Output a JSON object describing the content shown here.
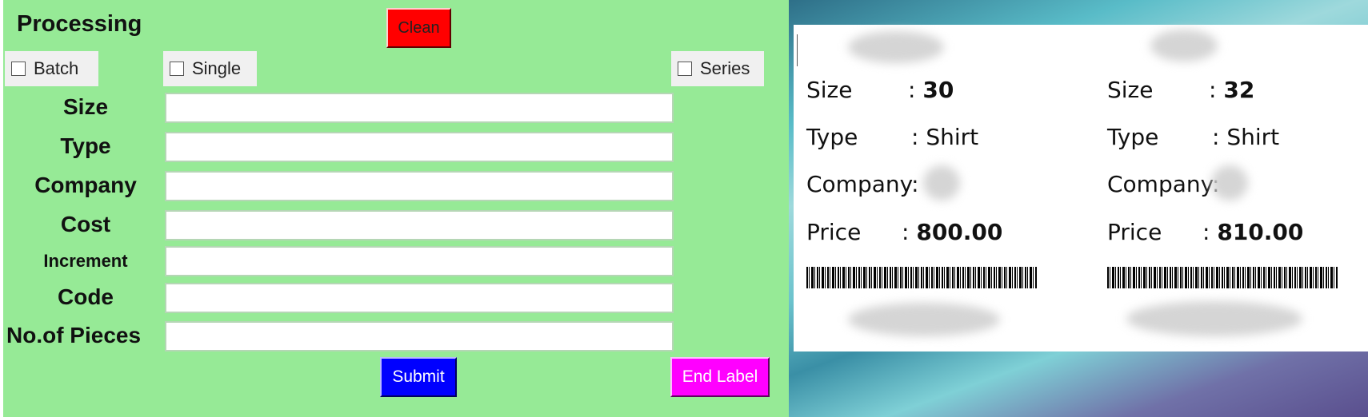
{
  "processing": {
    "title": "Processing",
    "clean_label": "Clean",
    "checkboxes": {
      "batch": "Batch",
      "single": "Single",
      "series": "Series"
    },
    "fields": {
      "size": {
        "label": "Size",
        "value": ""
      },
      "type": {
        "label": "Type",
        "value": ""
      },
      "company": {
        "label": "Company",
        "value": ""
      },
      "cost": {
        "label": "Cost",
        "value": ""
      },
      "increment": {
        "label": "Increment",
        "value": ""
      },
      "code": {
        "label": "Code",
        "value": ""
      },
      "pieces": {
        "label": "No.of Pieces",
        "value": ""
      }
    },
    "submit_label": "Submit",
    "end_label": "End Label"
  },
  "preview": {
    "labels": [
      {
        "size_key": "Size",
        "size_sep": ":",
        "size": "30",
        "type_key": "Type",
        "type_sep": ":",
        "type": "Shirt",
        "company_key": "Company:",
        "price_key": "Price",
        "price_sep": ":",
        "price": "800.00"
      },
      {
        "size_key": "Size",
        "size_sep": ":",
        "size": "32",
        "type_key": "Type",
        "type_sep": ":",
        "type": "Shirt",
        "company_key": "Company:",
        "price_key": "Price",
        "price_sep": ":",
        "price": "810.00"
      }
    ]
  }
}
